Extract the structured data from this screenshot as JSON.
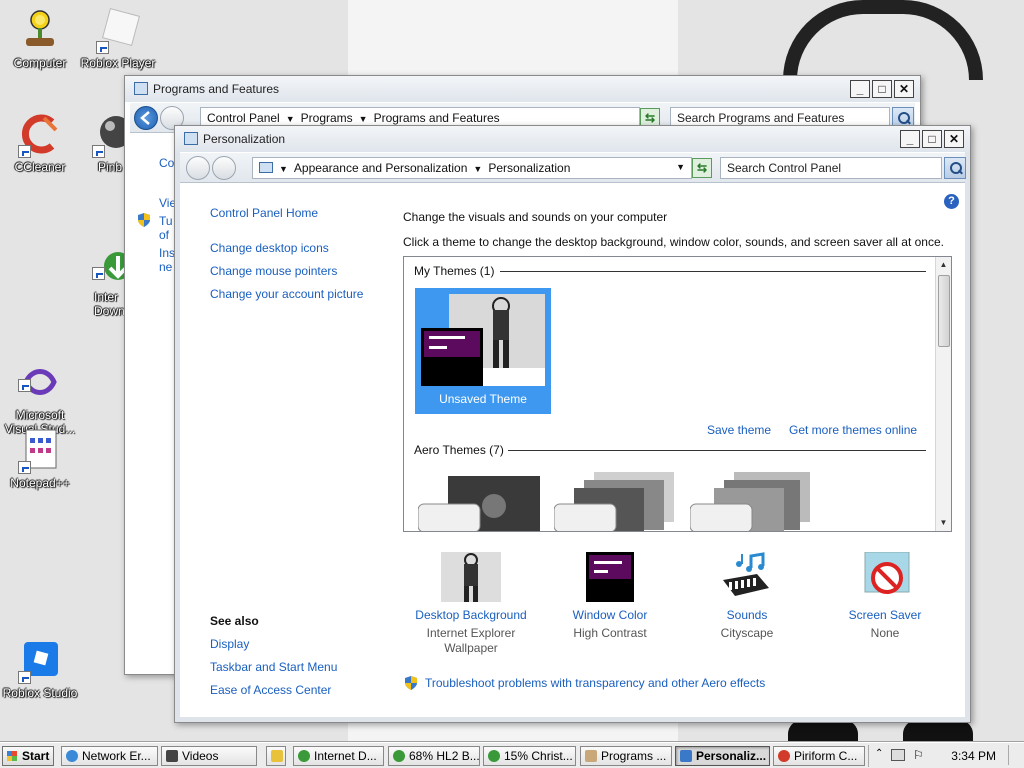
{
  "desktop": {
    "icons": [
      {
        "id": "computer",
        "label": "Computer"
      },
      {
        "id": "roblox-player",
        "label": "Roblox Player"
      },
      {
        "id": "ccleaner",
        "label": "CCleaner"
      },
      {
        "id": "pinball",
        "label": "Pinb"
      },
      {
        "id": "internet-download",
        "label": "Inter\nDown"
      },
      {
        "id": "visual-studio",
        "label": "Microsoft\nVisual Stud..."
      },
      {
        "id": "notepadpp",
        "label": "Notepad++"
      },
      {
        "id": "roblox-studio",
        "label": "Roblox Studio"
      }
    ]
  },
  "programs_window": {
    "title": "Programs and Features",
    "breadcrumb": [
      "Control Panel",
      "Programs",
      "Programs and Features"
    ],
    "search_placeholder": "Search Programs and Features",
    "side_fragments": [
      "Co",
      "Vie",
      "Tu\nof",
      "Ins\nne"
    ]
  },
  "personalization_window": {
    "title": "Personalization",
    "breadcrumb": [
      "Appearance and Personalization",
      "Personalization"
    ],
    "search_placeholder": "Search Control Panel",
    "help": "?",
    "nav_links": [
      "Control Panel Home",
      "Change desktop icons",
      "Change mouse pointers",
      "Change your account picture"
    ],
    "see_also_title": "See also",
    "see_also_links": [
      "Display",
      "Taskbar and Start Menu",
      "Ease of Access Center"
    ],
    "heading": "Change the visuals and sounds on your computer",
    "subheading": "Click a theme to change the desktop background, window color, sounds, and screen saver all at once.",
    "groups": {
      "my_themes": "My Themes (1)",
      "aero_themes": "Aero Themes (7)"
    },
    "unsaved_theme": "Unsaved Theme",
    "save_theme": "Save theme",
    "more_themes": "Get more themes online",
    "bottom_items": [
      {
        "id": "desktop-background",
        "title": "Desktop Background",
        "sub": "Internet Explorer\nWallpaper"
      },
      {
        "id": "window-color",
        "title": "Window Color",
        "sub": "High Contrast"
      },
      {
        "id": "sounds",
        "title": "Sounds",
        "sub": "Cityscape"
      },
      {
        "id": "screen-saver",
        "title": "Screen Saver",
        "sub": "None"
      }
    ],
    "troubleshoot": "Troubleshoot problems with transparency and other Aero effects"
  },
  "taskbar": {
    "start": "Start",
    "items": [
      {
        "id": "network-error",
        "label": "Network Er..."
      },
      {
        "id": "videos",
        "label": "Videos"
      },
      {
        "id": "internet-d",
        "label": "Internet D..."
      },
      {
        "id": "hl2",
        "label": "68% HL2 B..."
      },
      {
        "id": "christ",
        "label": "15% Christ..."
      },
      {
        "id": "programs",
        "label": "Programs ..."
      },
      {
        "id": "personaliz",
        "label": "Personaliz..."
      },
      {
        "id": "piriform",
        "label": "Piriform C..."
      }
    ],
    "clock": "3:34 PM"
  },
  "colors": {
    "accent": "#3e98f0",
    "link": "#1a5fbf",
    "theme_purple": "#5c0a5e"
  }
}
